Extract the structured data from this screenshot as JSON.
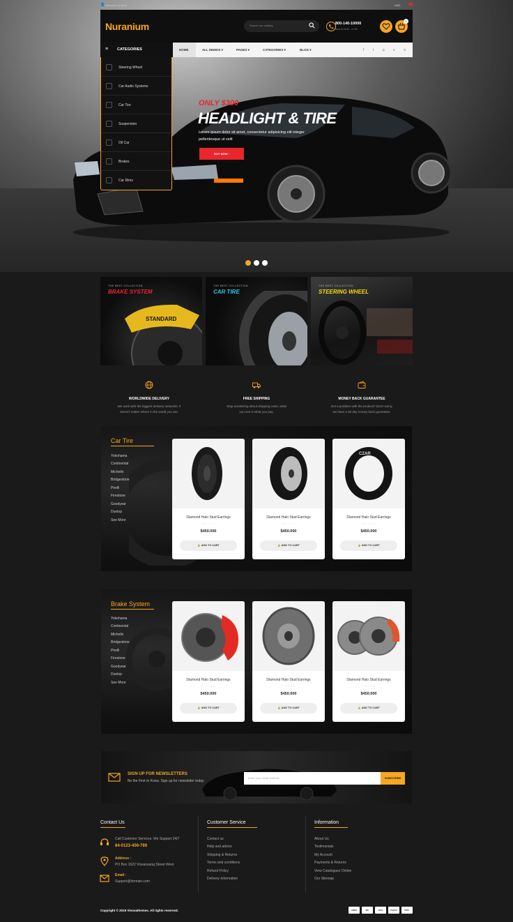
{
  "topbar": {
    "welcome": "Welcome to store",
    "lang": "USD"
  },
  "header": {
    "logo": "Nuranium",
    "search_placeholder": "Search our catalog",
    "phone": "800-140-10000",
    "phone_sub": "Mon-Fri 8:00 - 17:00",
    "cart_count": "2"
  },
  "nav": {
    "categories_label": "CATEGORIES",
    "items": [
      "HOME",
      "ALL DEMOS",
      "PAGES",
      "CATEGORIES",
      "BLOG"
    ],
    "social": [
      "f",
      "t",
      "p",
      "v",
      "o"
    ]
  },
  "category_menu": [
    "Steering Wheel",
    "Car Audio Systems",
    "Car Tire",
    "Suspension",
    "Oil Car",
    "Brakes",
    "Car Rims"
  ],
  "hero": {
    "pre": "ONLY $300",
    "title": "HEADLIGHT & TIRE",
    "text": "Lorem ipsum dolor sit amet, consectetur adipisicing elit integer pellentesque ut velit",
    "button": "BUY NOW"
  },
  "banners": [
    {
      "small": "THE BEST COLLECTION",
      "title": "BRAKE SYSTEM",
      "color": "#e8262b"
    },
    {
      "small": "THE BEST COLLECTION",
      "title": "CAR TIRE",
      "color": "#2ec7e6"
    },
    {
      "small": "THE BEST COLLECTION",
      "title": "STEERING WHEEL",
      "color": "#f5d90a"
    }
  ],
  "features": [
    {
      "icon": "globe-icon",
      "title": "WORLDWIDE DELIVERY",
      "desc1": "We work with the biggest delivery networks. It",
      "desc2": "doesn't matter where in the world you are."
    },
    {
      "icon": "truck-icon",
      "title": "FREE SHIPPING",
      "desc1": "Stop wondering about shipping costs, what",
      "desc2": "you see is what you pay."
    },
    {
      "icon": "wallet-icon",
      "title": "MONEY BACK GUARANTEE",
      "desc1": "Got a problem with the product? Don't worry,",
      "desc2": "we have a 30 day money back guarantee."
    }
  ],
  "sections": [
    {
      "title": "Car Tire",
      "brands": [
        "Yokohama",
        "Continental",
        "Michelin",
        "Bridgestone",
        "Pirelli",
        "Firestone",
        "Goodyear",
        "Dunlop",
        "See More"
      ],
      "products": [
        {
          "name": "Diamond Halo Stud Earrings",
          "price": "$450.000",
          "cart": "ADD TO CART"
        },
        {
          "name": "Diamond Halo Stud Earrings",
          "price": "$450.000",
          "cart": "ADD TO CART"
        },
        {
          "name": "Diamond Halo Stud Earrings",
          "price": "$450.000",
          "cart": "ADD TO CART"
        }
      ]
    },
    {
      "title": "Brake System",
      "brands": [
        "Yokohama",
        "Continental",
        "Michelin",
        "Bridgestone",
        "Pirelli",
        "Firestone",
        "Goodyear",
        "Dunlop",
        "See More"
      ],
      "products": [
        {
          "name": "Diamond Halo Stud Earrings",
          "price": "$450.000",
          "cart": "ADD TO CART"
        },
        {
          "name": "Diamond Halo Stud Earrings",
          "price": "$450.000",
          "cart": "ADD TO CART"
        },
        {
          "name": "Diamond Halo Stud Earrings",
          "price": "$450.000",
          "cart": "ADD TO CART"
        }
      ]
    }
  ],
  "newsletter": {
    "title": "SIGN UP FOR NEWSLETTERS",
    "desc": "Be the First to Know. Sign up for newsletter today",
    "placeholder": "Enter your email address",
    "button": "SUBSCRIBE"
  },
  "footer": {
    "contact_title": "Contact Us",
    "contact_support": "Call Customer Services, We Support 24/7",
    "contact_phone": "84-0123-456-789",
    "address_label": "Address :",
    "address": "PO Box 1622 Vissaosang Street West",
    "email_label": "Email :",
    "email": "Support@domain.com",
    "service_title": "Customer Service",
    "service_links": [
      "Contact us",
      "Help and advice",
      "Shipping & Returns",
      "Terms and conditions",
      "Refund Policy",
      "Delivery information"
    ],
    "info_title": "Information",
    "info_links": [
      "About Us",
      "Testimonials",
      "My Account",
      "Payments & Returns",
      "View Catalogues Online",
      "Our Sitemap"
    ],
    "copyright": "Copyright © 2019 Vinovathemes. All rights reserved.",
    "payments": [
      "AMEX",
      "MC",
      "VISA",
      "PayPal",
      "DISC"
    ]
  },
  "colors": {
    "accent": "#f5a623",
    "red": "#e8262b"
  }
}
